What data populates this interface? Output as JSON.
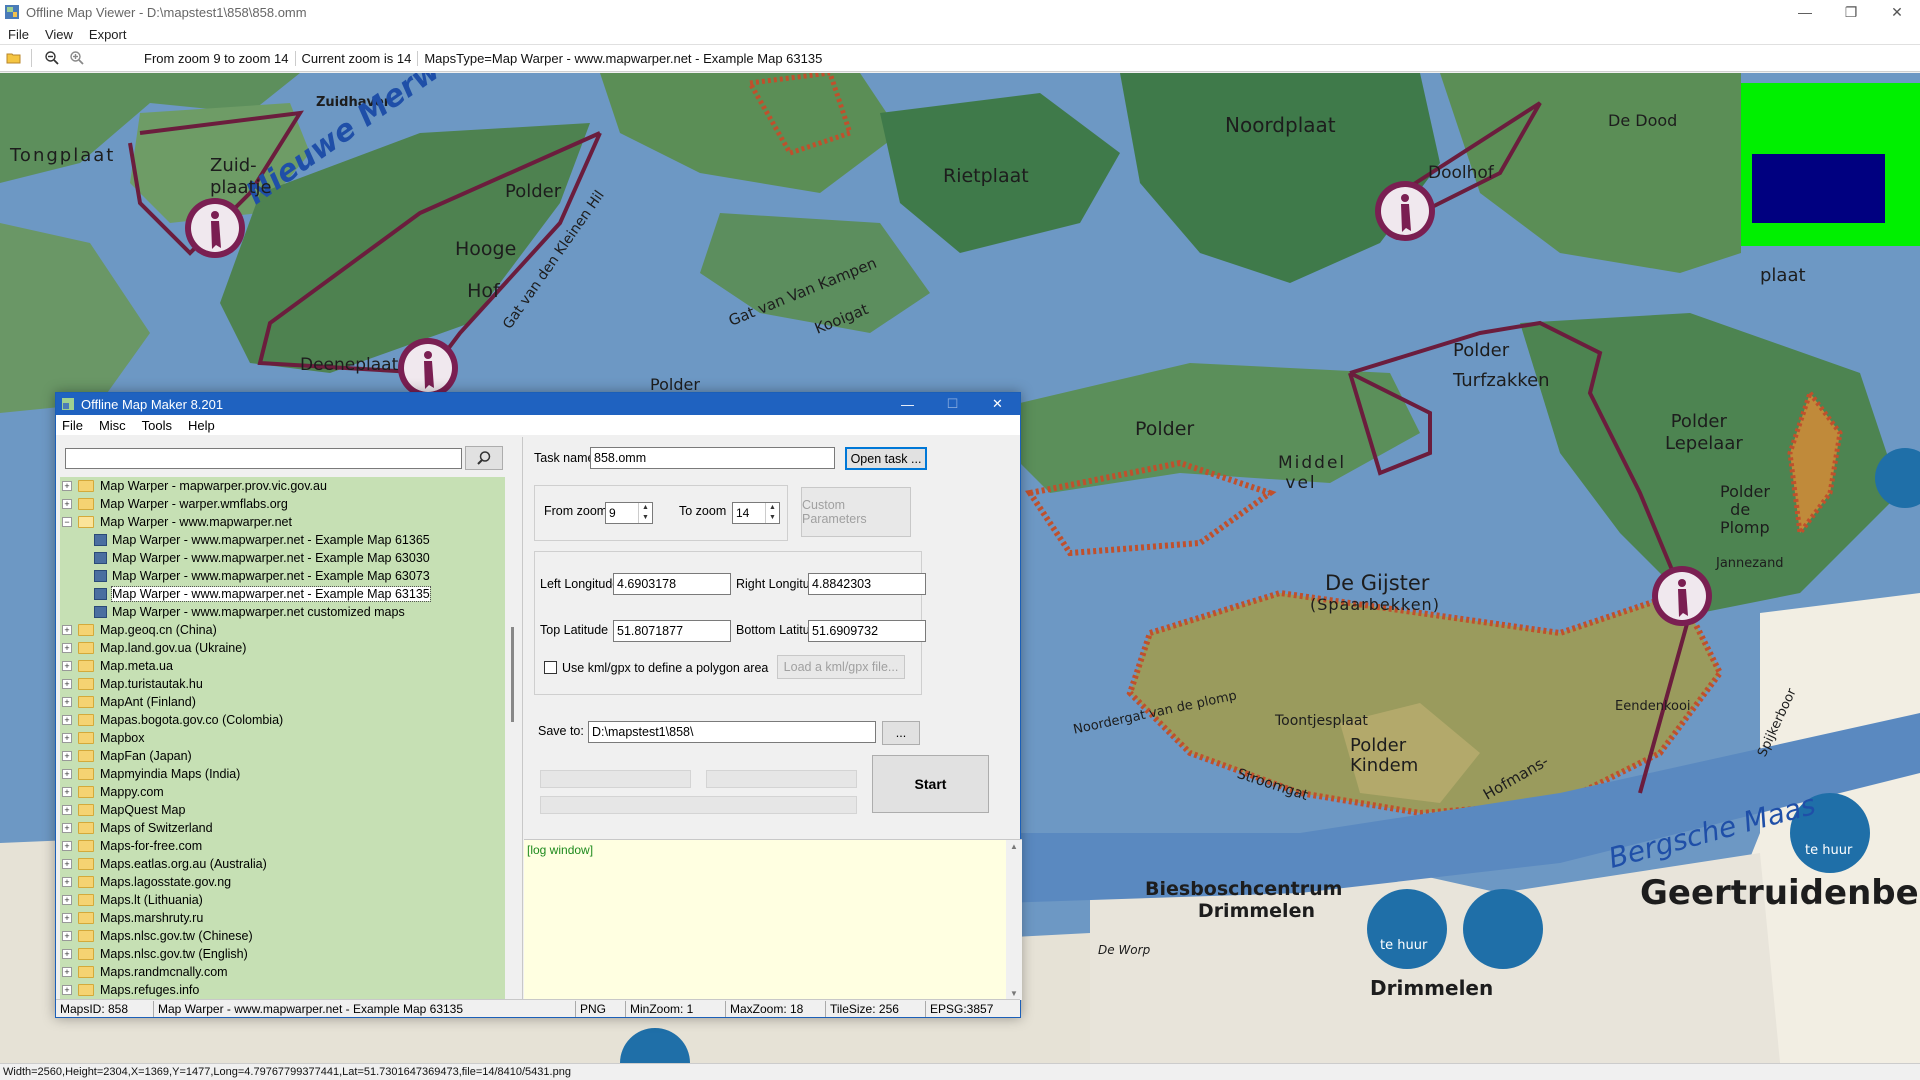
{
  "window": {
    "title": "Offline Map Viewer - D:\\mapstest1\\858\\858.omm",
    "controls": [
      "—",
      "❐",
      "✕"
    ]
  },
  "menu": [
    "File",
    "View",
    "Export"
  ],
  "toolbar": {
    "zoom_range": "From zoom 9 to zoom 14",
    "current_zoom": "Current zoom is 14",
    "maps_type": "MapsType=Map Warper - www.mapwarper.net - Example Map 63135"
  },
  "map": {
    "labels": {
      "zuidhaven": "Zuidhaven",
      "nieuwe_merwede": "Nieuwe Merwede",
      "tongplaat": "Tongplaat",
      "zuid_plaatje": "Zuid-\nplaatje",
      "polder_top": "Polder",
      "hooge_hof": "Hooge\nHof",
      "gat_kleinen_hil": "Gat van den Kleinen Hil",
      "deeneplaat": "Deeneplaat",
      "gat_van_kampen": "Gat van Van Kampen",
      "kooigat": "Kooigat",
      "rietplaat": "Rietplaat",
      "noordplaat": "Noordplaat",
      "doolhof": "Doolhof",
      "de_dood": "De Dood",
      "plaat": "plaat",
      "polder_turfzakken": "Polder\nTurfzakken",
      "polder_lepelaar": "Polder\nLepelaar",
      "polder_mid": "Polder",
      "polder_de_plomp": "Polder\nde\nPlomp",
      "jannezand": "Jannezand",
      "middelvel": "Middel\nvel",
      "de_gijster": "De Gijster",
      "spaarbekken": "(Spaarbekken)",
      "noordergat": "Noordergat van de plomp",
      "toontjesplaat": "Toontjesplaat",
      "polder_kindem": "Polder\nKindem",
      "stroomgat": "Stroomgat",
      "hofmans": "Hofmans-",
      "eendenkooi": "Eendenkooi",
      "spijkerboor": "Spijkerboor",
      "bergsche_maas": "Bergsche Maas",
      "biesboschcentrum": "Biesboschcentrum\nDrimmelen",
      "drimmelen": "Drimmelen",
      "de_worp": "De Worp",
      "geertruidenberg": "Geertruidenbe",
      "te_huur": "te huur",
      "polder_small": "Polder"
    }
  },
  "coords_status": "Width=2560,Height=2304,X=1369,Y=1477,Long=4.79767799377441,Lat=51.7301647369473,file=14/8410/5431.png",
  "dialog": {
    "title": "Offline Map Maker 8.201",
    "menu": [
      "File",
      "Misc",
      "Tools",
      "Help"
    ],
    "search": {
      "value": "",
      "button_icon": "search-icon"
    },
    "tree": [
      {
        "label": "Map Warper - mapwarper.prov.vic.gov.au",
        "type": "folder",
        "expanded": false
      },
      {
        "label": "Map Warper - warper.wmflabs.org",
        "type": "folder",
        "expanded": false
      },
      {
        "label": "Map Warper - www.mapwarper.net",
        "type": "folder",
        "expanded": true
      },
      {
        "label": "Map Warper - www.mapwarper.net - Example Map 61365",
        "type": "map"
      },
      {
        "label": "Map Warper - www.mapwarper.net - Example Map 63030",
        "type": "map"
      },
      {
        "label": "Map Warper - www.mapwarper.net - Example Map 63073",
        "type": "map"
      },
      {
        "label": "Map Warper - www.mapwarper.net - Example Map 63135",
        "type": "map",
        "selected": true
      },
      {
        "label": "Map Warper - www.mapwarper.net customized maps",
        "type": "map"
      },
      {
        "label": "Map.geoq.cn (China)",
        "type": "folder"
      },
      {
        "label": "Map.land.gov.ua (Ukraine)",
        "type": "folder"
      },
      {
        "label": "Map.meta.ua",
        "type": "folder"
      },
      {
        "label": "Map.turistautak.hu",
        "type": "folder"
      },
      {
        "label": "MapAnt (Finland)",
        "type": "folder"
      },
      {
        "label": "Mapas.bogota.gov.co (Colombia)",
        "type": "folder"
      },
      {
        "label": "Mapbox",
        "type": "folder"
      },
      {
        "label": "MapFan (Japan)",
        "type": "folder"
      },
      {
        "label": "Mapmyindia Maps (India)",
        "type": "folder"
      },
      {
        "label": "Mappy.com",
        "type": "folder"
      },
      {
        "label": "MapQuest Map",
        "type": "folder"
      },
      {
        "label": "Maps of Switzerland",
        "type": "folder"
      },
      {
        "label": "Maps-for-free.com",
        "type": "folder"
      },
      {
        "label": "Maps.eatlas.org.au (Australia)",
        "type": "folder"
      },
      {
        "label": "Maps.lagosstate.gov.ng",
        "type": "folder"
      },
      {
        "label": "Maps.lt (Lithuania)",
        "type": "folder"
      },
      {
        "label": "Maps.marshruty.ru",
        "type": "folder"
      },
      {
        "label": "Maps.nlsc.gov.tw (Chinese)",
        "type": "folder"
      },
      {
        "label": "Maps.nlsc.gov.tw (English)",
        "type": "folder"
      },
      {
        "label": "Maps.randmcnally.com",
        "type": "folder"
      },
      {
        "label": "Maps.refuges.info",
        "type": "folder"
      }
    ],
    "task_name_label": "Task name",
    "task_name": "858.omm",
    "open_task": "Open task ...",
    "from_zoom_label": "From zoom",
    "from_zoom": "9",
    "to_zoom_label": "To zoom",
    "to_zoom": "14",
    "custom_params": "Custom Parameters",
    "left_lon_label": "Left Longitude",
    "left_lon": "4.6903178",
    "right_lon_label": "Right Longitude",
    "right_lon": "4.8842303",
    "top_lat_label": "Top Latitude",
    "top_lat": "51.8071877",
    "bottom_lat_label": "Bottom Latitude",
    "bottom_lat": "51.6909732",
    "kml_checkbox_label": "Use kml/gpx to define a polygon area",
    "load_kml": "Load a kml/gpx file...",
    "save_to_label": "Save to:",
    "save_to": "D:\\mapstest1\\858\\",
    "browse": "...",
    "start": "Start",
    "log_text": "[log window]",
    "status": {
      "maps_id": "MapsID: 858",
      "map_name": "Map Warper - www.mapwarper.net - Example Map 63135",
      "format": "PNG",
      "min_zoom": "MinZoom: 1",
      "max_zoom": "MaxZoom: 18",
      "tile_size": "TileSize: 256",
      "epsg": "EPSG:3857"
    }
  }
}
